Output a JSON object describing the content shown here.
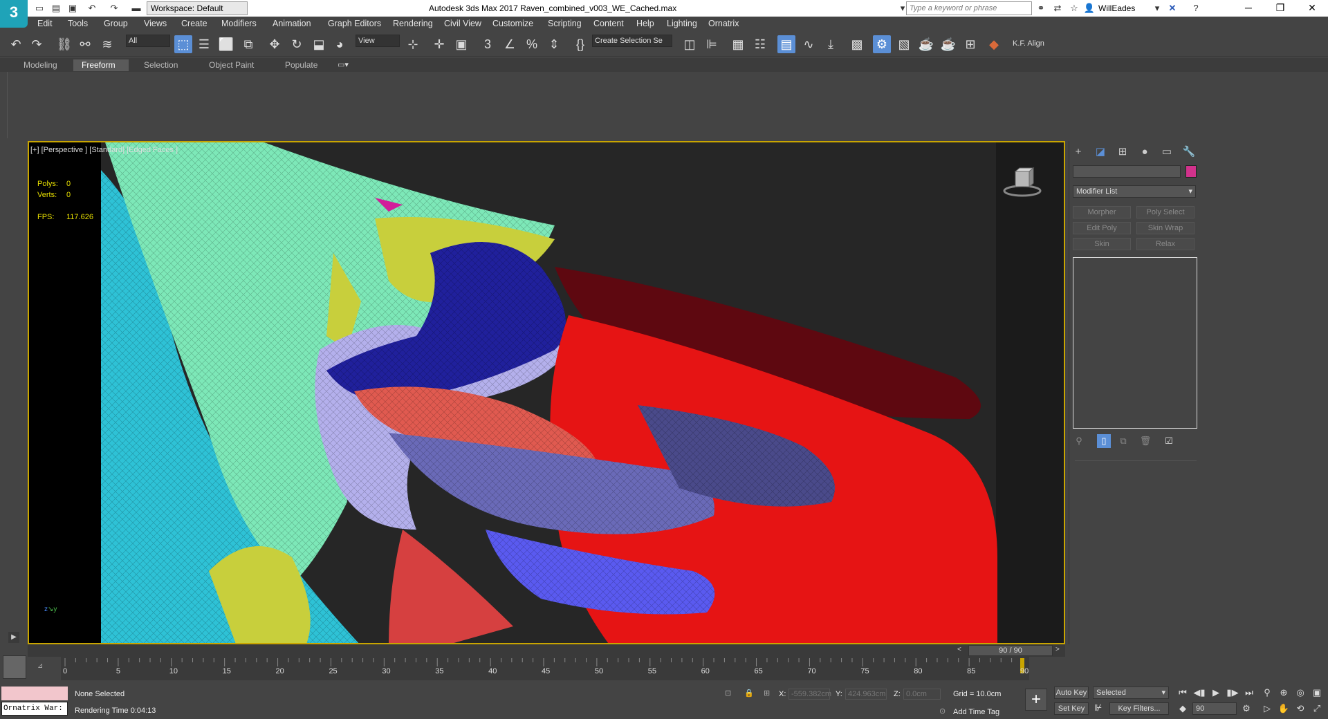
{
  "titlebar": {
    "logo": "3",
    "workspace": "Workspace: Default",
    "window_title": "Autodesk 3ds Max 2017      Raven_combined_v003_WE_Cached.max",
    "search_placeholder": "Type a keyword or phrase",
    "user": "WillEades"
  },
  "menubar": {
    "items": [
      "Edit",
      "Tools",
      "Group",
      "Views",
      "Create",
      "Modifiers",
      "Animation",
      "Graph Editors",
      "Rendering",
      "Civil View",
      "Customize",
      "Scripting",
      "Content",
      "Help",
      "Lighting",
      "Ornatrix"
    ]
  },
  "toolbar": {
    "selection_filter": "All",
    "reference_coord": "View",
    "named_selection": "Create Selection Se",
    "kf_align": "K.F. Align"
  },
  "ribbon": {
    "tabs": [
      "Modeling",
      "Freeform",
      "Selection",
      "Object Paint",
      "Populate"
    ],
    "active_tab": "Freeform"
  },
  "viewport": {
    "label": "[+] [Perspective ] [Standard] [Edged Faces ]",
    "polys_label": "Polys:",
    "polys_value": "0",
    "verts_label": "Verts:",
    "verts_value": "0",
    "fps_label": "FPS:",
    "fps_value": "117.626"
  },
  "command_panel": {
    "modifier_list": "Modifier List",
    "modifier_buttons": [
      "Morpher",
      "Poly Select",
      "Edit Poly",
      "Skin Wrap",
      "Skin",
      "Relax"
    ],
    "object_color": "#d2328c"
  },
  "timeline": {
    "frame_display": "90 / 90",
    "ticks": [
      "0",
      "5",
      "10",
      "15",
      "20",
      "25",
      "30",
      "35",
      "40",
      "45",
      "50",
      "55",
      "60",
      "65",
      "70",
      "75",
      "80",
      "85",
      "90"
    ]
  },
  "statusbar": {
    "maxscript_output": "Ornatrix War:",
    "selection_status": "None Selected",
    "render_time": "Rendering Time  0:04:13",
    "x_label": "X:",
    "x_value": "-559.382cm",
    "y_label": "Y:",
    "y_value": "424.963cm",
    "z_label": "Z:",
    "z_value": "0.0cm",
    "grid": "Grid = 10.0cm",
    "add_time_tag": "Add Time Tag",
    "auto_key": "Auto Key",
    "set_key": "Set Key",
    "selected_dd": "Selected",
    "key_filters": "Key Filters...",
    "current_frame": "90"
  }
}
